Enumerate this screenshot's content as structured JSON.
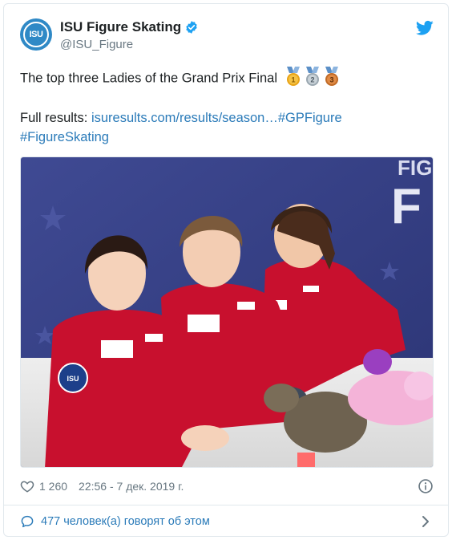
{
  "author": {
    "avatar_text": "ISU",
    "display_name": "ISU Figure Skating",
    "handle": "@ISU_Figure",
    "verified_icon": "verified-badge-icon",
    "brand_icon": "twitter-bird-icon"
  },
  "tweet": {
    "line1": "The top three Ladies of the Grand Prix Final",
    "medal_labels": [
      "1",
      "2",
      "3"
    ],
    "results_prefix": "Full results: ",
    "results_link": "isuresults.com/results/season…",
    "hashtag1": "#GPFigure",
    "hashtag2": "#FigureSkating"
  },
  "photo": {
    "backdrop_text": "FIG",
    "backdrop_text2": "F",
    "badge_text": "ISU"
  },
  "meta": {
    "like_count": "1 260",
    "timestamp": "22:56 - 7 дек. 2019 г."
  },
  "footer": {
    "conversation_label": "477 человек(а) говорят об этом"
  },
  "colors": {
    "link": "#2b7bb9",
    "twitter_blue": "#1da1f2",
    "muted": "#697882",
    "jacket_red": "#c8102e"
  }
}
